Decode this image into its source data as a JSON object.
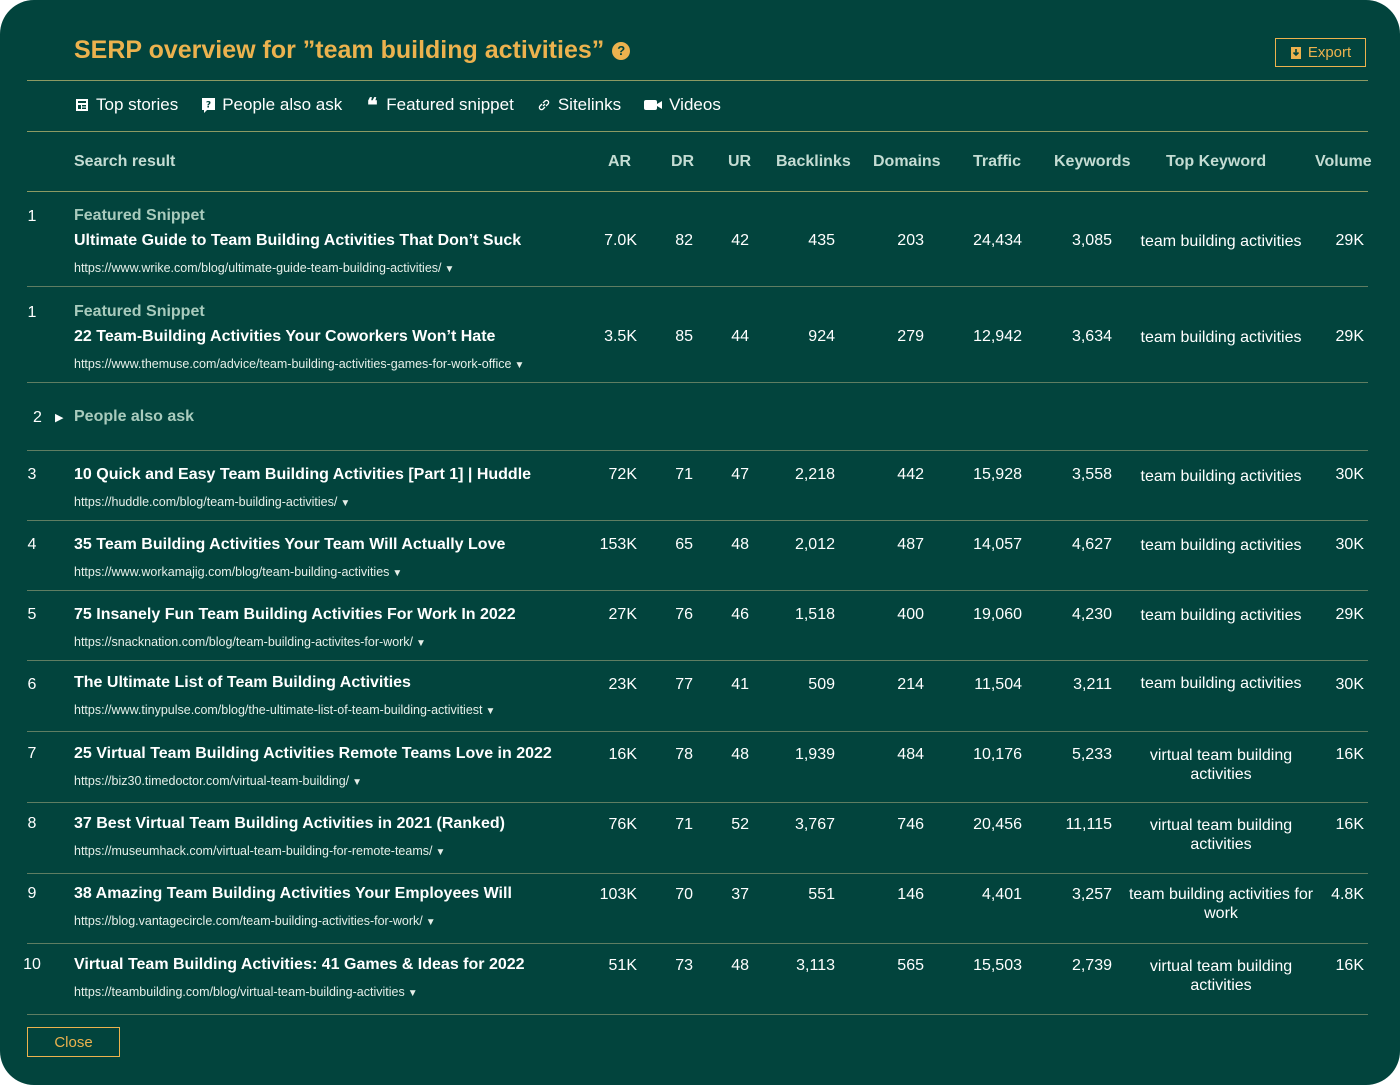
{
  "title": "SERP overview for ”team building activities”",
  "help_glyph": "?",
  "export_label": "Export",
  "close_label": "Close",
  "features": [
    {
      "icon": "newspaper-icon",
      "label": "Top stories"
    },
    {
      "icon": "question-box-icon",
      "label": "People also ask"
    },
    {
      "icon": "quote-icon",
      "label": "Featured snippet"
    },
    {
      "icon": "link-icon",
      "label": "Sitelinks"
    },
    {
      "icon": "video-camera-icon",
      "label": "Videos"
    }
  ],
  "columns": {
    "search_result": "Search result",
    "ar": "AR",
    "dr": "DR",
    "ur": "UR",
    "backlinks": "Backlinks",
    "domains": "Domains",
    "traffic": "Traffic",
    "keywords": "Keywords",
    "top_keyword": "Top Keyword",
    "volume": "Volume"
  },
  "featured_label": "Featured Snippet",
  "people_also_ask": {
    "rank": "2",
    "label": "People also ask"
  },
  "colors": {
    "background": "#02443d",
    "accent": "#ecb24e",
    "muted": "#a9cbbd"
  },
  "rows": [
    {
      "rank": "1",
      "featured": true,
      "title": "Ultimate Guide to Team Building Activities That Don’t Suck",
      "url": "https://www.wrike.com/blog/ultimate-guide-team-building-activities/",
      "ar": "7.0K",
      "dr": "82",
      "ur": "42",
      "backlinks": "435",
      "domains": "203",
      "traffic": "24,434",
      "keywords": "3,085",
      "top_keyword": "team building activities",
      "volume": "29K"
    },
    {
      "rank": "1",
      "featured": true,
      "title": "22 Team-Building Activities Your Coworkers Won’t Hate",
      "url": "https://www.themuse.com/advice/team-building-activities-games-for-work-office",
      "ar": "3.5K",
      "dr": "85",
      "ur": "44",
      "backlinks": "924",
      "domains": "279",
      "traffic": "12,942",
      "keywords": "3,634",
      "top_keyword": "team building activities",
      "volume": "29K"
    },
    {
      "rank": "3",
      "featured": false,
      "title": "10 Quick and Easy Team Building Activities [Part 1] | Huddle",
      "url": "https://huddle.com/blog/team-building-activities/",
      "ar": "72K",
      "dr": "71",
      "ur": "47",
      "backlinks": "2,218",
      "domains": "442",
      "traffic": "15,928",
      "keywords": "3,558",
      "top_keyword": "team building activities",
      "volume": "30K"
    },
    {
      "rank": "4",
      "featured": false,
      "title": "35 Team Building Activities Your Team Will Actually Love",
      "url": "https://www.workamajig.com/blog/team-building-activities",
      "ar": "153K",
      "dr": "65",
      "ur": "48",
      "backlinks": "2,012",
      "domains": "487",
      "traffic": "14,057",
      "keywords": "4,627",
      "top_keyword": "team building activities",
      "volume": "30K"
    },
    {
      "rank": "5",
      "featured": false,
      "title": "75 Insanely Fun Team Building Activities For Work In 2022",
      "url": "https://snacknation.com/blog/team-building-activites-for-work/",
      "ar": "27K",
      "dr": "76",
      "ur": "46",
      "backlinks": "1,518",
      "domains": "400",
      "traffic": "19,060",
      "keywords": "4,230",
      "top_keyword": "team building activities",
      "volume": "29K"
    },
    {
      "rank": "6",
      "featured": false,
      "title": "The Ultimate List of Team Building Activities",
      "url": "https://www.tinypulse.com/blog/the-ultimate-list-of-team-building-activitiest",
      "ar": "23K",
      "dr": "77",
      "ur": "41",
      "backlinks": "509",
      "domains": "214",
      "traffic": "11,504",
      "keywords": "3,211",
      "top_keyword": "team building activities",
      "volume": "30K"
    },
    {
      "rank": "7",
      "featured": false,
      "title": "25 Virtual Team Building Activities Remote Teams Love in 2022",
      "url": "https://biz30.timedoctor.com/virtual-team-building/",
      "ar": "16K",
      "dr": "78",
      "ur": "48",
      "backlinks": "1,939",
      "domains": "484",
      "traffic": "10,176",
      "keywords": "5,233",
      "top_keyword": "virtual team building activities",
      "volume": "16K"
    },
    {
      "rank": "8",
      "featured": false,
      "title": "37 Best Virtual Team Building Activities in 2021 (Ranked)",
      "url": "https://museumhack.com/virtual-team-building-for-remote-teams/",
      "ar": "76K",
      "dr": "71",
      "ur": "52",
      "backlinks": "3,767",
      "domains": "746",
      "traffic": "20,456",
      "keywords": "11,115",
      "top_keyword": "virtual team building activities",
      "volume": "16K"
    },
    {
      "rank": "9",
      "featured": false,
      "title": "38 Amazing Team Building Activities Your Employees Will",
      "url": "https://blog.vantagecircle.com/team-building-activities-for-work/",
      "ar": "103K",
      "dr": "70",
      "ur": "37",
      "backlinks": "551",
      "domains": "146",
      "traffic": "4,401",
      "keywords": "3,257",
      "top_keyword": "team building activities for work",
      "volume": "4.8K"
    },
    {
      "rank": "10",
      "featured": false,
      "title": "Virtual Team Building Activities: 41 Games & Ideas for 2022",
      "url": "https://teambuilding.com/blog/virtual-team-building-activities",
      "ar": "51K",
      "dr": "73",
      "ur": "48",
      "backlinks": "3,113",
      "domains": "565",
      "traffic": "15,503",
      "keywords": "2,739",
      "top_keyword": "virtual team building activities",
      "volume": "16K"
    }
  ]
}
